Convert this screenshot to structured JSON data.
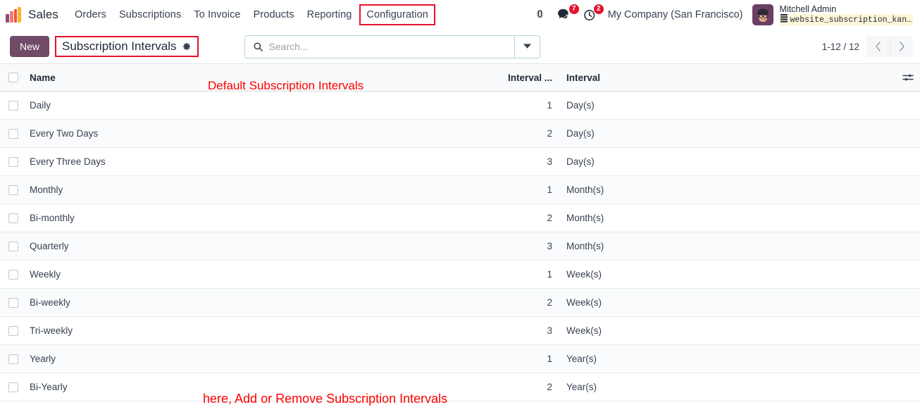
{
  "navbar": {
    "logo_icon": "sales-app-bars-icon",
    "brand": "Sales",
    "menu_items": [
      {
        "label": "Orders",
        "highlighted": false
      },
      {
        "label": "Subscriptions",
        "highlighted": false
      },
      {
        "label": "To Invoice",
        "highlighted": false
      },
      {
        "label": "Products",
        "highlighted": false
      },
      {
        "label": "Reporting",
        "highlighted": false
      },
      {
        "label": "Configuration",
        "highlighted": true
      }
    ],
    "sys_icons": [
      {
        "name": "bug-icon",
        "badge": null
      },
      {
        "name": "messages-icon",
        "badge": "7"
      },
      {
        "name": "activities-clock-icon",
        "badge": "2"
      }
    ],
    "company": "My Company (San Francisco)",
    "user": {
      "name": "Mitchell Admin",
      "database_icon": "database-icon",
      "database": "website_subscription_kan…",
      "avatar_icon": "user-avatar"
    }
  },
  "control_panel": {
    "new_label": "New",
    "breadcrumb_title": "Subscription Intervals",
    "gear_icon": "gear-icon",
    "search_icon": "search-icon",
    "search_value": "",
    "search_placeholder": "Search...",
    "search_toggle_icon": "chevron-down-icon",
    "pager_value": "1-12 / 12",
    "pager_prev_icon": "chevron-left-icon",
    "pager_next_icon": "chevron-right-icon"
  },
  "list": {
    "columns": {
      "name": "Name",
      "interval_number": "Interval ...",
      "interval_unit": "Interval"
    },
    "optional_columns_icon": "column-settings-icon",
    "select_all_checkbox": false,
    "rows": [
      {
        "name": "Daily",
        "interval_number": "1",
        "interval_unit": "Day(s)"
      },
      {
        "name": "Every Two Days",
        "interval_number": "2",
        "interval_unit": "Day(s)"
      },
      {
        "name": "Every Three Days",
        "interval_number": "3",
        "interval_unit": "Day(s)"
      },
      {
        "name": "Monthly",
        "interval_number": "1",
        "interval_unit": "Month(s)"
      },
      {
        "name": "Bi-monthly",
        "interval_number": "2",
        "interval_unit": "Month(s)"
      },
      {
        "name": "Quarterly",
        "interval_number": "3",
        "interval_unit": "Month(s)"
      },
      {
        "name": "Weekly",
        "interval_number": "1",
        "interval_unit": "Week(s)"
      },
      {
        "name": "Bi-weekly",
        "interval_number": "2",
        "interval_unit": "Week(s)"
      },
      {
        "name": "Tri-weekly",
        "interval_number": "3",
        "interval_unit": "Week(s)"
      },
      {
        "name": "Yearly",
        "interval_number": "1",
        "interval_unit": "Year(s)"
      },
      {
        "name": "Bi-Yearly",
        "interval_number": "2",
        "interval_unit": "Year(s)"
      }
    ]
  },
  "annotations": {
    "top": "Default Subscription Intervals",
    "bottom": "here, Add or Remove Subscription Intervals",
    "color": "#ff0000"
  },
  "colors": {
    "brand_purple": "#714b67",
    "annotation_red": "#ff0000",
    "highlight_box_red": "#e8112d",
    "badge_red": "#e8112d",
    "db_tag_bg": "#fdf6d8"
  }
}
